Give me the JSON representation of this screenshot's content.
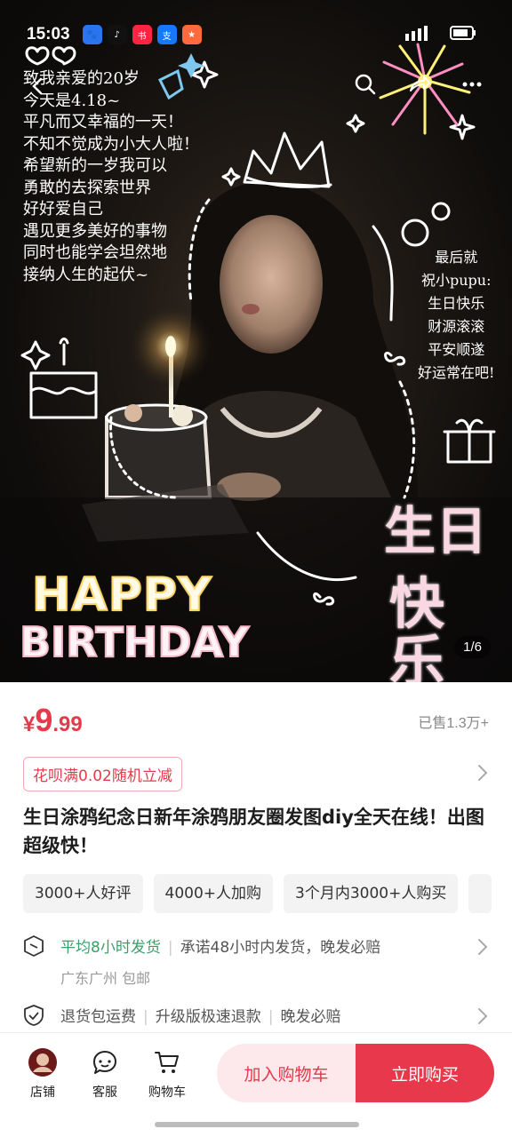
{
  "status_bar": {
    "time": "15:03",
    "apps": [
      "baidu",
      "tiktok",
      "xiaohongshu",
      "alipay",
      "other"
    ]
  },
  "hero": {
    "note_left": [
      "致我亲爱的20岁",
      "今天是4.18~",
      "平凡而又幸福的一天！",
      "不知不觉成为小大人啦！",
      "希望新的一岁我可以",
      "勇敢的去探索世界",
      "好好爱自己",
      "遇见更多美好的事物",
      "同时也能学会坦然地",
      "接纳人生的起伏~"
    ],
    "note_right": [
      "最后就",
      "祝小pupu:",
      "生日快乐",
      "财源滚滚",
      "平安顺遂",
      "好运常在吧!"
    ],
    "happy": "HAPPY",
    "birthday": "BIRTHDAY",
    "cn_line1": "生日",
    "cn_line2": "快乐",
    "counter": "1/6"
  },
  "product": {
    "price_symbol": "¥",
    "price_int": "9",
    "price_dec": ".99",
    "sold": "已售1.3万+",
    "promo": "花呗满0.02随机立减",
    "title": "生日涂鸦纪念日新年涂鸦朋友圈发图diy全天在线！出图超级快！",
    "tags": [
      "3000+人好评",
      "4000+人加购",
      "3个月内3000+人购买"
    ],
    "shipping": {
      "highlight": "平均8小时发货",
      "promise": "承诺48小时内发货，晚发必赔",
      "location": "广东广州 包邮"
    },
    "returns": {
      "item1": "退货包运费",
      "item2": "升级版极速退款",
      "item3": "晚发必赔"
    }
  },
  "bottom_bar": {
    "store": "店铺",
    "service": "客服",
    "cart": "购物车",
    "add_to_cart": "加入购物车",
    "buy_now": "立即购买"
  },
  "colors": {
    "accent": "#e8394c",
    "green": "#3aa06a",
    "promo_border": "#f2aab2"
  }
}
